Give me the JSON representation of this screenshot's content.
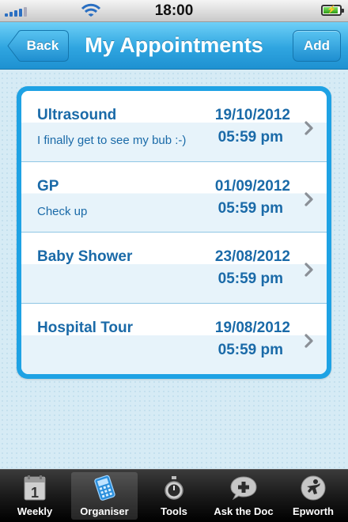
{
  "status_bar": {
    "time": "18:00",
    "signal_icon": "signal-bars-icon",
    "wifi_icon": "wifi-icon",
    "battery_icon": "battery-charging-icon",
    "battery_level": 0.9
  },
  "nav": {
    "title": "My Appointments",
    "back_label": "Back",
    "add_label": "Add"
  },
  "appointments": [
    {
      "title": "Ultrasound",
      "note": "I finally get to see my bub :-)",
      "date": "19/10/2012",
      "time": "05:59 pm"
    },
    {
      "title": "GP",
      "note": "Check up",
      "date": "01/09/2012",
      "time": "05:59 pm"
    },
    {
      "title": "Baby Shower",
      "note": "",
      "date": "23/08/2012",
      "time": "05:59 pm"
    },
    {
      "title": "Hospital Tour",
      "note": "",
      "date": "19/08/2012",
      "time": "05:59 pm"
    }
  ],
  "tabs": [
    {
      "label": "Weekly",
      "icon": "calendar-icon",
      "selected": false
    },
    {
      "label": "Organiser",
      "icon": "organiser-icon",
      "selected": true
    },
    {
      "label": "Tools",
      "icon": "stopwatch-icon",
      "selected": false
    },
    {
      "label": "Ask the Doc",
      "icon": "speech-plus-icon",
      "selected": false
    },
    {
      "label": "Epworth",
      "icon": "epworth-logo-icon",
      "selected": false
    }
  ],
  "colors": {
    "accent": "#1ea2e4",
    "text": "#1a6aa8",
    "tab_bar": "#1a1a1a"
  }
}
